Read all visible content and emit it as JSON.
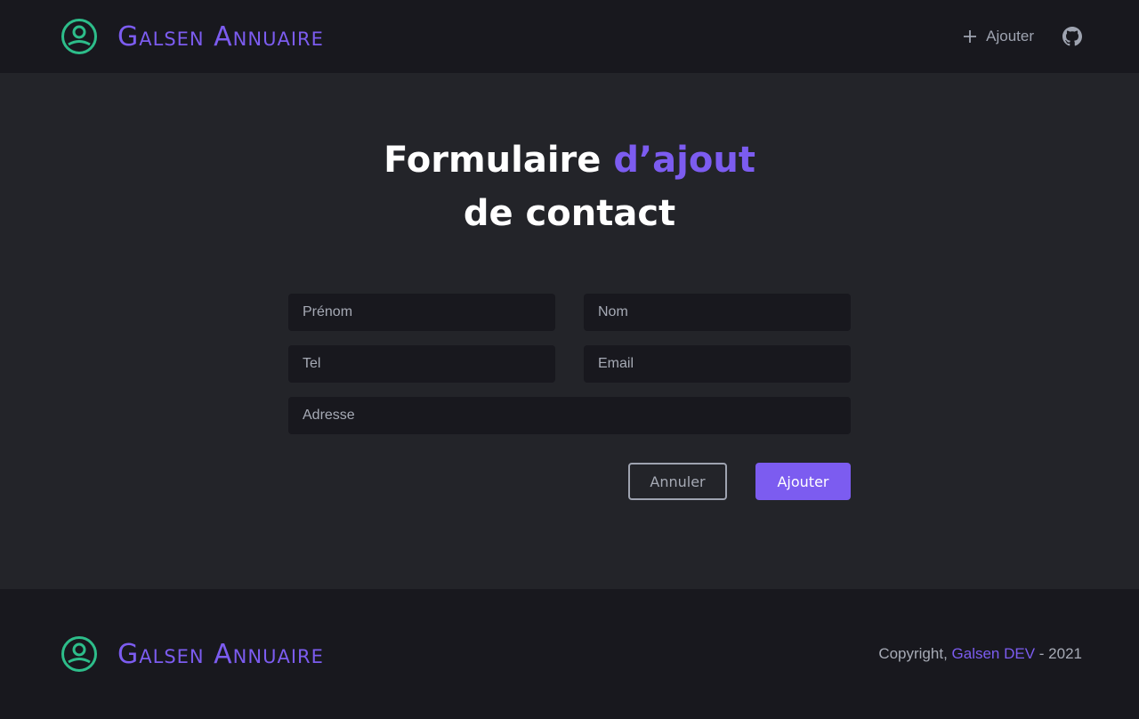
{
  "header": {
    "brand_name": "Galsen Annuaire",
    "nav_add_label": "Ajouter",
    "github_icon": "github-icon"
  },
  "main": {
    "title_part1": "Formulaire ",
    "title_accent": "d’ajout",
    "title_line2": "de contact"
  },
  "form": {
    "firstname_placeholder": "Prénom",
    "lastname_placeholder": "Nom",
    "phone_placeholder": "Tel",
    "email_placeholder": "Email",
    "address_placeholder": "Adresse",
    "cancel_label": "Annuler",
    "submit_label": "Ajouter"
  },
  "footer": {
    "brand_name": "Galsen Annuaire",
    "copyright_prefix": "Copyright, ",
    "company": "Galsen DEV",
    "copyright_suffix": " - 2021"
  },
  "colors": {
    "accent": "#7c5cf0",
    "logo_green": "#2dbd8a",
    "header_bg": "#18181e",
    "page_bg": "#232429"
  }
}
